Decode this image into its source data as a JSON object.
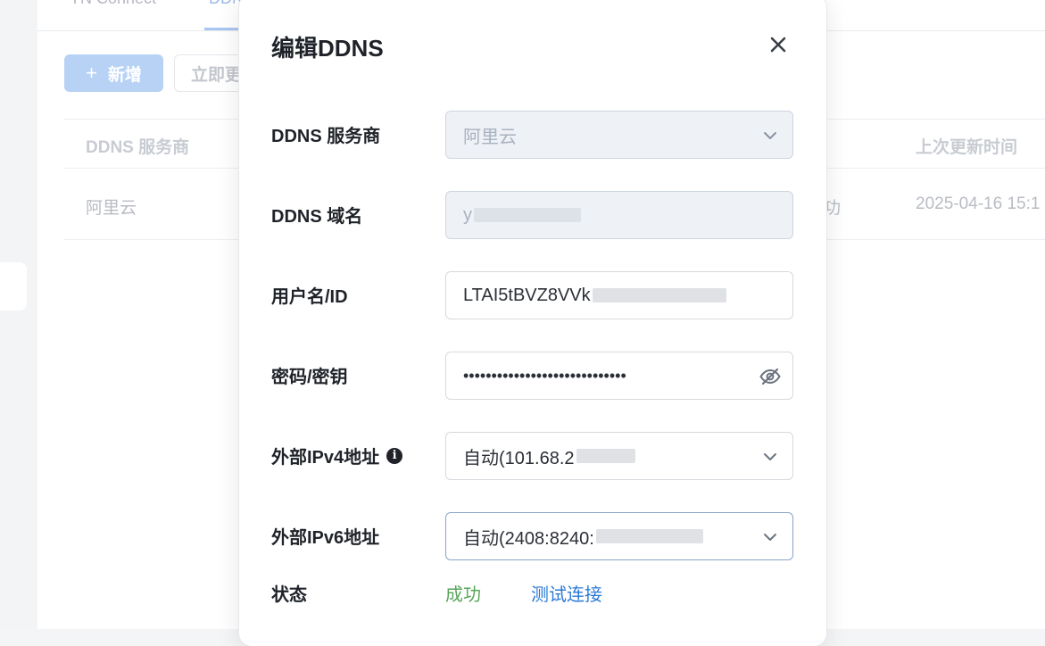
{
  "background": {
    "tabs": [
      "YN Connect",
      "DDNS"
    ],
    "add_button": "新增",
    "update_button": "立即更新",
    "table_headers": [
      "DDNS 服务商",
      "上次更新时间"
    ],
    "rows": [
      {
        "provider": "阿里云",
        "status": "成功",
        "updated": "2025-04-16 15:1"
      }
    ]
  },
  "modal": {
    "title": "编辑DDNS",
    "fields": {
      "provider": {
        "label": "DDNS 服务商",
        "value": "阿里云"
      },
      "domain": {
        "label": "DDNS 域名",
        "value": "y"
      },
      "username": {
        "label": "用户名/ID",
        "value": "LTAI5tBVZ8VVk"
      },
      "password": {
        "label": "密码/密钥",
        "value": "•••••••••••••••••••••••••••••"
      },
      "ipv4": {
        "label": "外部IPv4地址",
        "value": "自动(101.68.2"
      },
      "ipv6": {
        "label": "外部IPv6地址",
        "value": "自动(2408:8240:"
      }
    },
    "status": {
      "label": "状态",
      "value": "成功",
      "test_link": "测试连接"
    }
  },
  "colors": {
    "accent": "#2b7ad6",
    "success": "#5aa55a"
  },
  "icons": [
    "close-icon",
    "chevron-down-icon",
    "eye-off-icon",
    "info-icon",
    "plus-icon"
  ]
}
